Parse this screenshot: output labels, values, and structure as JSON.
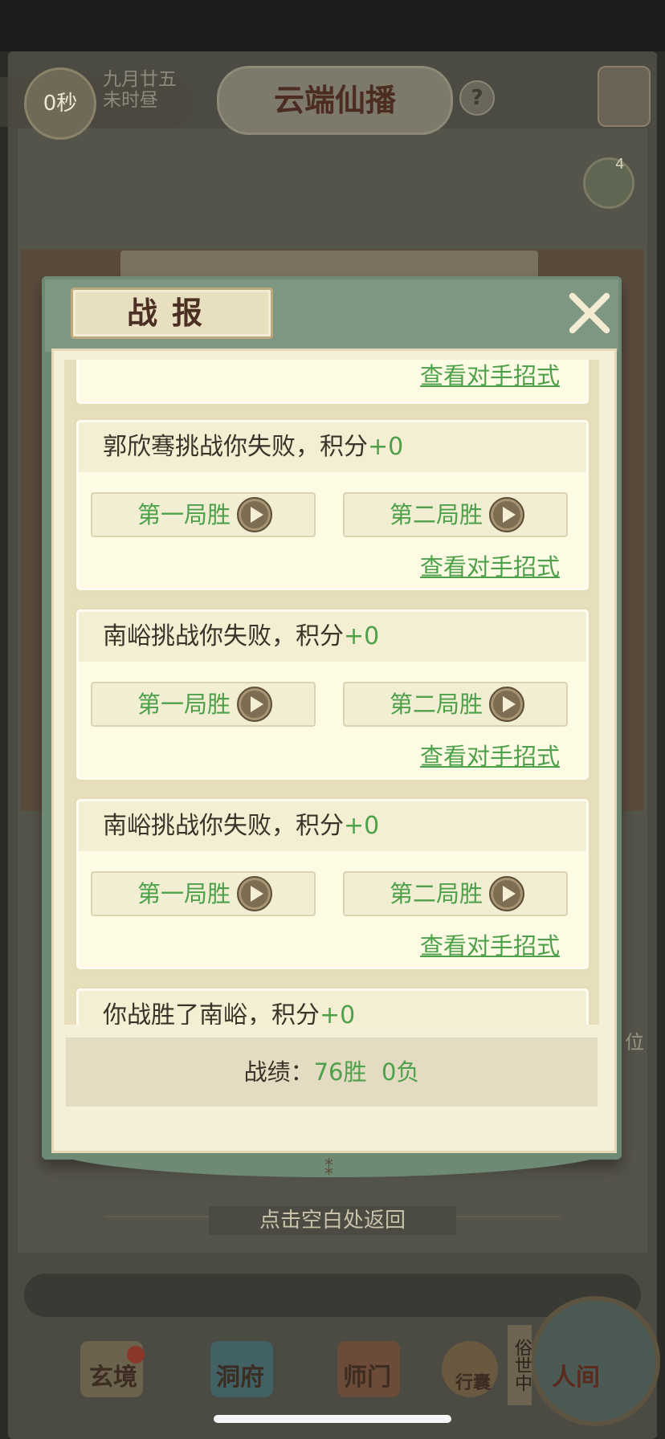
{
  "hud": {
    "timer": "0秒",
    "date_line1": "九月廿五",
    "date_line2": "未时昼",
    "title": "云端仙播",
    "help": "?",
    "chat_count": "4",
    "side_label": "位"
  },
  "dialog": {
    "title": "战报",
    "records": [
      {
        "title": "",
        "points": "",
        "round1": "",
        "round2": "",
        "view": "查看对手招式"
      },
      {
        "title": "郭欣骞挑战你失败，积分",
        "points": "+0",
        "round1": "第一局胜",
        "round2": "第二局胜",
        "view": "查看对手招式"
      },
      {
        "title": "南峪挑战你失败，积分",
        "points": "+0",
        "round1": "第一局胜",
        "round2": "第二局胜",
        "view": "查看对手招式"
      },
      {
        "title": "南峪挑战你失败，积分",
        "points": "+0",
        "round1": "第一局胜",
        "round2": "第二局胜",
        "view": "查看对手招式"
      },
      {
        "title": "你战胜了南峪，积分",
        "points": "+0",
        "round1": "",
        "round2": "",
        "view": ""
      }
    ],
    "stats_label": "战绩：",
    "stats_wins": "76胜",
    "stats_losses": "0负"
  },
  "return_hint": "点击空白处返回",
  "nav": {
    "items": [
      "玄境",
      "洞府",
      "师门",
      "行囊",
      "人间"
    ],
    "world_side": "俗世中"
  },
  "colors": {
    "accent_green": "#4ea04a",
    "dialog_frame": "#6f8a74",
    "paper": "#f4efd7"
  }
}
